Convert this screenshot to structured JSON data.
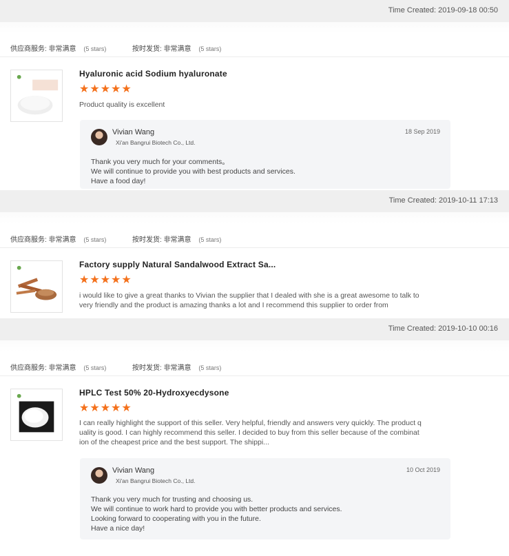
{
  "ratings_labels": {
    "service_label": "供应商服务:",
    "service_value": "非常满意",
    "ontime_label": "按时发货:",
    "ontime_value": "非常满意",
    "stars_note": "(5 stars)"
  },
  "reviews": [
    {
      "time_created": "Time Created: 2019-09-18 00:50",
      "product_title": "Hyaluronic acid Sodium hyaluronate",
      "stars": "★★★★★",
      "review_lines": [
        "Product quality is excellent"
      ],
      "reply": {
        "name": "Vivian Wang",
        "company": "Xi'an  Bangrui Biotech Co., Ltd.",
        "date": "18 Sep 2019",
        "lines": [
          "Thank you very much for your comments。",
          "We will continue to provide you with best products and services.",
          "Have a food day!"
        ]
      }
    },
    {
      "time_created": "Time Created: 2019-10-11 17:13",
      "product_title": "Factory supply Natural Sandalwood Extract Sa...",
      "stars": "★★★★★",
      "review_lines": [
        "i would like to give a great thanks to Vivian the supplier that I dealed with she is a great awesome to talk to",
        "very friendly and the product is amazing thanks a lot and I recommend this supplier to order from"
      ]
    },
    {
      "time_created": "Time Created: 2019-10-10 00:16",
      "product_title": "HPLC Test 50% 20-Hydroxyecdysone",
      "stars": "★★★★★",
      "review_lines": [
        "I can really highlight the support of this seller. Very helpful, friendly and answers very quickly. The product q",
        "uality is good. I can highly recommend this seller. I decided to buy from this seller because of the combinat",
        "ion of the cheapest price and the best support. The shippi..."
      ],
      "reply": {
        "name": "Vivian Wang",
        "company": "Xi'an  Bangrui Biotech Co., Ltd.",
        "date": "10 Oct 2019",
        "lines": [
          "Thank you very much for trusting and choosing us.",
          "We will continue to work hard to provide you with better products and services.",
          "Looking forward to cooperating with you in the future.",
          "Have a nice day!"
        ]
      }
    }
  ],
  "colors": {
    "star": "#f4711c",
    "band": "#efefef",
    "reply_bg": "#f4f5f7"
  },
  "icons": [
    "avatar",
    "product-thumbnail",
    "star-icon"
  ]
}
